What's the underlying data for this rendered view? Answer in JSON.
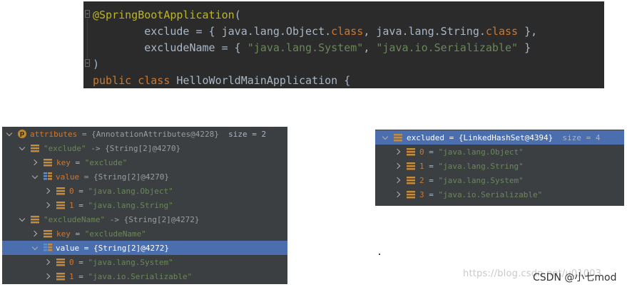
{
  "editor": {
    "line1": {
      "annotation": "@SpringBootApplication",
      "paren": "("
    },
    "line2": {
      "indent": "        ",
      "key": "exclude = { ",
      "t1": "java.lang.Object.",
      "k1": "class",
      "sep": ", ",
      "t2": "java.lang.String.",
      "k2": "class",
      "end": " },"
    },
    "line3": {
      "indent": "        ",
      "key": "excludeName = { ",
      "s1": "\"java.lang.System\"",
      "sep": ", ",
      "s2": "\"java.io.Serializable\"",
      "end": " }"
    },
    "line4": {
      "text": ")"
    },
    "line5": {
      "kw1": "public",
      "kw2": "class",
      "name": "HelloWorldMainApplication {"
    }
  },
  "left_tree": {
    "rows": [
      {
        "name": "attributes",
        "rest": " = {AnnotationAttributes@4228}",
        "size": "  size = 2"
      },
      {
        "key": "\"exclude\"",
        "rest": " -> {String[2]@4270}"
      },
      {
        "name": "key",
        "eq": " = ",
        "val": "\"exclude\""
      },
      {
        "name": "value",
        "rest": " = {String[2]@4270}"
      },
      {
        "name": "0",
        "eq": " = ",
        "val": "\"java.lang.Object\""
      },
      {
        "name": "1",
        "eq": " = ",
        "val": "\"java.lang.String\""
      },
      {
        "key": "\"excludeName\"",
        "rest": " -> {String[2]@4272}"
      },
      {
        "name": "key",
        "eq": " = ",
        "val": "\"excludeName\""
      },
      {
        "name": "value",
        "rest": " = {String[2]@4272}"
      },
      {
        "name": "0",
        "eq": " = ",
        "val": "\"java.lang.System\""
      },
      {
        "name": "1",
        "eq": " = ",
        "val": "\"java.io.Serializable\""
      }
    ]
  },
  "right_tree": {
    "rows": [
      {
        "name": "excluded",
        "rest": " = {LinkedHashSet@4394}",
        "size": "  size = 4"
      },
      {
        "name": "0",
        "eq": " = ",
        "val": "\"java.lang.Object\""
      },
      {
        "name": "1",
        "eq": " = ",
        "val": "\"java.lang.String\""
      },
      {
        "name": "2",
        "eq": " = ",
        "val": "\"java.lang.System\""
      },
      {
        "name": "3",
        "eq": " = ",
        "val": "\"java.io.Serializable\""
      }
    ]
  },
  "icons": {
    "property": "p",
    "field": "field-icon",
    "array": "array-icon",
    "expand": "chevron-down-icon",
    "collapse": "chevron-right-icon"
  },
  "colors": {
    "editor_bg": "#2b2b2b",
    "panel_bg": "#3c3f41",
    "selection": "#4b6eaf",
    "keyword": "#cc7832",
    "string": "#6a8759",
    "annotation": "#bbb529"
  },
  "watermark": "https://blog.csdn.net/u01003",
  "credit": "CSDN @小七mod"
}
